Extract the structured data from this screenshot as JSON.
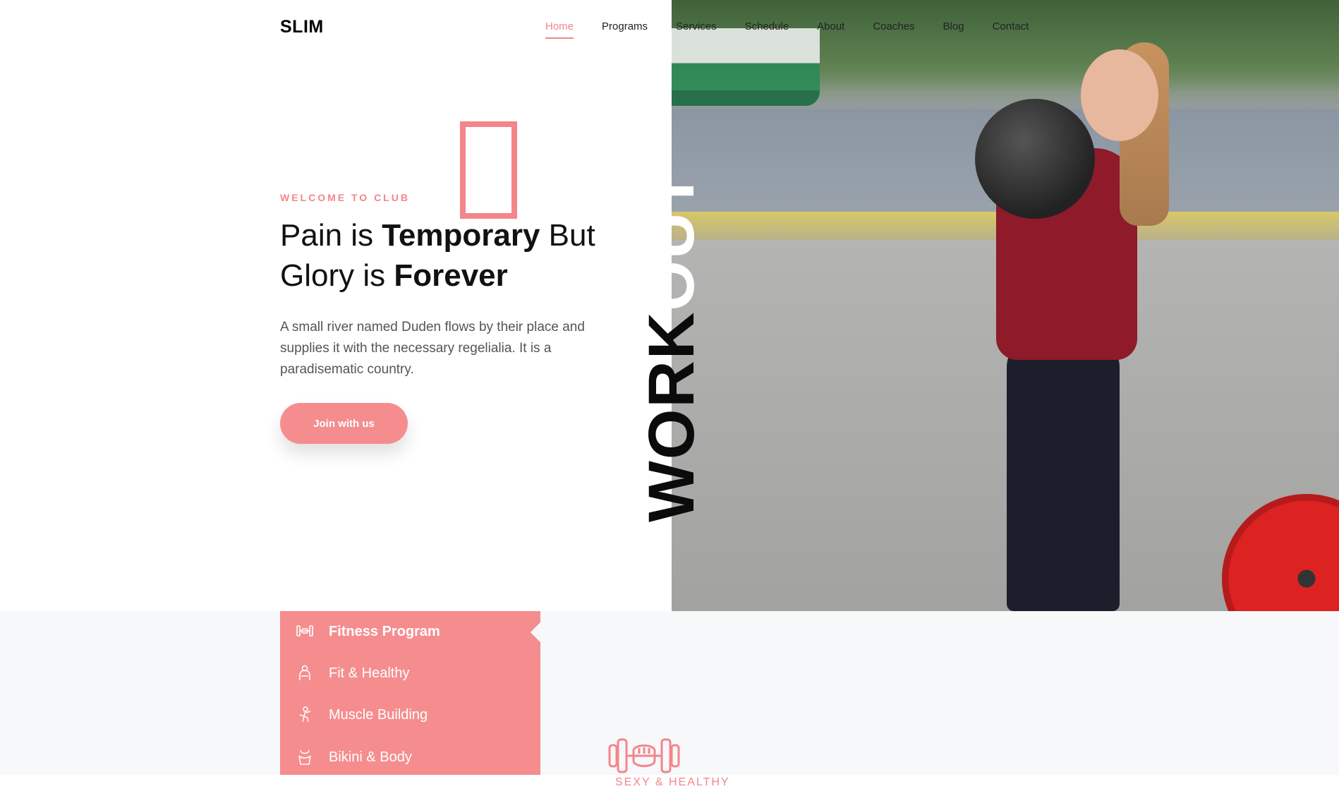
{
  "brand": {
    "logo": "SLIM"
  },
  "nav": {
    "items": [
      {
        "label": "Home",
        "active": true
      },
      {
        "label": "Programs"
      },
      {
        "label": "Services"
      },
      {
        "label": "Schedule"
      },
      {
        "label": "About"
      },
      {
        "label": "Coaches"
      },
      {
        "label": "Blog"
      },
      {
        "label": "Contact"
      }
    ]
  },
  "hero": {
    "welcome": "WELCOME TO CLUB",
    "headline": {
      "line1_a": "Pain is ",
      "line1_b": "Temporary",
      "line1_c": " But",
      "line2_a": "Glory is ",
      "line2_b": "Forever"
    },
    "description": "A small river named Duden flows by their place and supplies it with the necessary regelialia. It is a paradisematic country.",
    "cta_label": "Join with us",
    "vertical_black": "WORK",
    "vertical_white": "OUT"
  },
  "programs": {
    "items": [
      {
        "label": "Fitness Program",
        "icon": "dumbbell-icon"
      },
      {
        "label": "Fit & Healthy",
        "icon": "fit-healthy-icon"
      },
      {
        "label": "Muscle Building",
        "icon": "muscle-building-icon"
      },
      {
        "label": "Bikini & Body",
        "icon": "bikini-body-icon"
      }
    ]
  },
  "section": {
    "label": "SEXY & HEALTHY"
  },
  "colors": {
    "accent": "#f4858b",
    "panel": "#f58d8f",
    "band": "#f7f8fa"
  }
}
